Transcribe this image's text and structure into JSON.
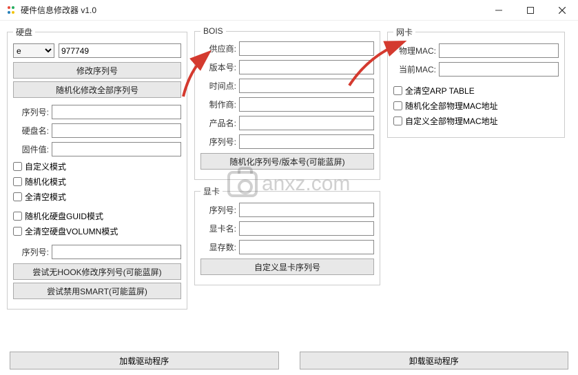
{
  "window": {
    "title": "硬件信息修改器 v1.0"
  },
  "hdd": {
    "legend": "硬盘",
    "drive_selected": "e",
    "drive_value": "977749",
    "btn_modify_serial": "修改序列号",
    "btn_randomize_all": "随机化修改全部序列号",
    "label_serial": "序列号:",
    "label_diskname": "硬盘名:",
    "label_firmware": "固件值:",
    "chk_custom_mode": "自定义模式",
    "chk_random_mode": "随机化模式",
    "chk_clear_mode": "全清空模式",
    "chk_random_guid": "随机化硬盘GUID模式",
    "chk_clear_volume": "全清空硬盘VOLUMN模式",
    "label_serial2": "序列号:",
    "btn_try_nohook": "尝试无HOOK修改序列号(可能蓝屏)",
    "btn_try_disable_smart": "尝试禁用SMART(可能蓝屏)"
  },
  "bios": {
    "legend": "BOIS",
    "label_vendor": "供应商:",
    "label_version": "版本号:",
    "label_time": "时间点:",
    "label_maker": "制作商:",
    "label_product": "产品名:",
    "label_serial": "序列号:",
    "btn_random": "随机化序列号/版本号(可能蓝屏)"
  },
  "gpu": {
    "legend": "显卡",
    "label_serial": "序列号:",
    "label_name": "显卡名:",
    "label_memory": "显存数:",
    "btn_custom": "自定义显卡序列号"
  },
  "nic": {
    "legend": "网卡",
    "label_phys_mac": "物理MAC:",
    "label_cur_mac": "当前MAC:",
    "chk_clear_arp": "全清空ARP TABLE",
    "chk_random_mac": "随机化全部物理MAC地址",
    "chk_custom_mac": "自定义全部物理MAC地址"
  },
  "footer": {
    "btn_load_driver": "加载驱动程序",
    "btn_unload_driver": "卸载驱动程序"
  },
  "watermark": {
    "text": "anxz.com"
  }
}
